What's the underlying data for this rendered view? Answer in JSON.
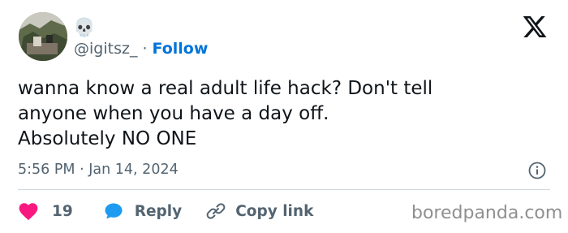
{
  "user": {
    "display_name": "💀",
    "handle": "@igitsz_",
    "separator": "·",
    "follow_label": "Follow"
  },
  "tweet": {
    "lines": [
      "wanna know a real adult life hack? Don't tell",
      "anyone when you have a day off.",
      "Absolutely NO ONE"
    ],
    "time": "5:56 PM",
    "meta_separator": "·",
    "date": "Jan 14, 2024"
  },
  "actions": {
    "like_count": "19",
    "reply_label": "Reply",
    "copy_label": "Copy link"
  },
  "icons": {
    "like": "heart-icon",
    "reply": "speech-bubble-icon",
    "copy": "link-icon",
    "info": "info-icon",
    "brand": "x-logo-icon"
  },
  "colors": {
    "like": "#f91880",
    "reply": "#1d9bf0",
    "follow": "#0074d9",
    "secondary_text": "#536471",
    "primary_text": "#0f1419"
  },
  "watermark": "boredpanda.com"
}
